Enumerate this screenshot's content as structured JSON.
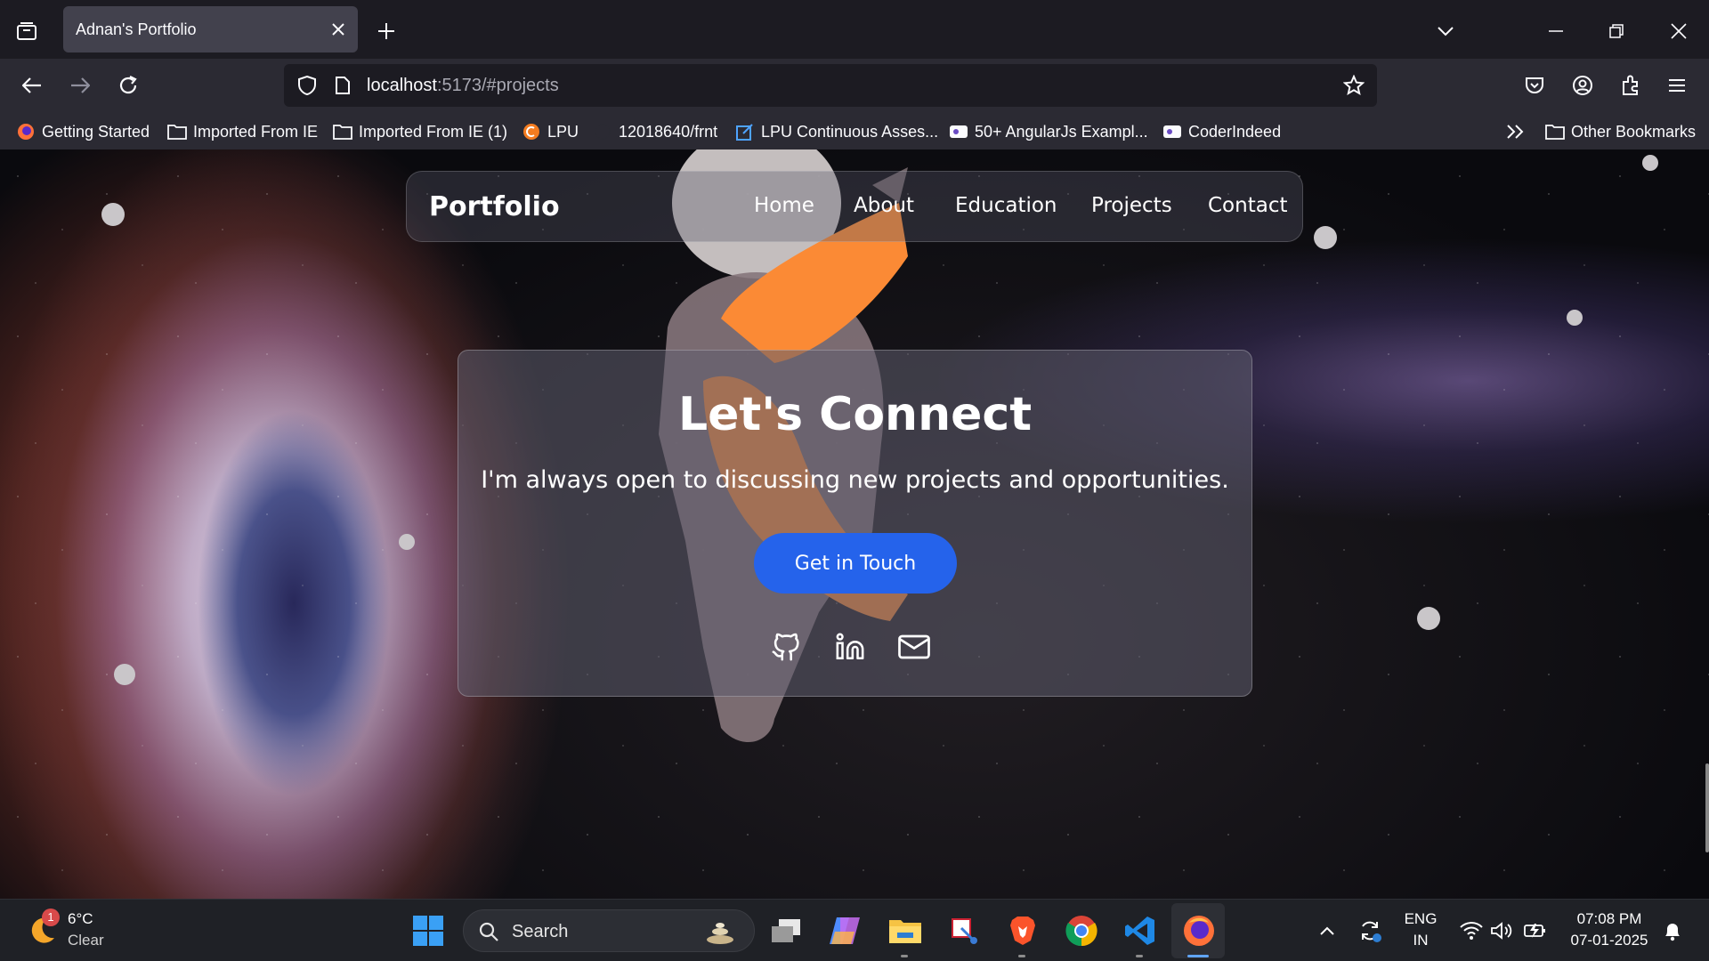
{
  "browser": {
    "tab_title": "Adnan's Portfolio",
    "url_host": "localhost",
    "url_rest": ":5173/#projects",
    "bookmarks": [
      {
        "label": "Getting Started",
        "icon": "firefox-icon"
      },
      {
        "label": "Imported From IE",
        "icon": "folder-icon"
      },
      {
        "label": "Imported From IE (1)",
        "icon": "folder-icon"
      },
      {
        "label": "LPU",
        "icon": "lpu-icon"
      },
      {
        "label": "12018640/frnt",
        "icon": "github-icon"
      },
      {
        "label": "LPU Continuous Asses...",
        "icon": "edit-icon"
      },
      {
        "label": "50+ AngularJs Exampl...",
        "icon": "site-icon"
      },
      {
        "label": "CoderIndeed",
        "icon": "site-icon"
      }
    ],
    "other_bookmarks": "Other Bookmarks"
  },
  "site": {
    "brand": "Portfolio",
    "nav": [
      "Home",
      "About",
      "Education",
      "Projects",
      "Contact"
    ],
    "heading": "Let's Connect",
    "subheading": "I'm always open to discussing new projects and opportunities.",
    "cta": "Get in Touch",
    "social": [
      "github-icon",
      "linkedin-icon",
      "mail-icon"
    ],
    "accent_color": "#2563eb"
  },
  "taskbar": {
    "weather_temp": "6°C",
    "weather_desc": "Clear",
    "weather_badge": "1",
    "search_placeholder": "Search",
    "lang_top": "ENG",
    "lang_bottom": "IN",
    "time": "07:08 PM",
    "date": "07-01-2025"
  }
}
